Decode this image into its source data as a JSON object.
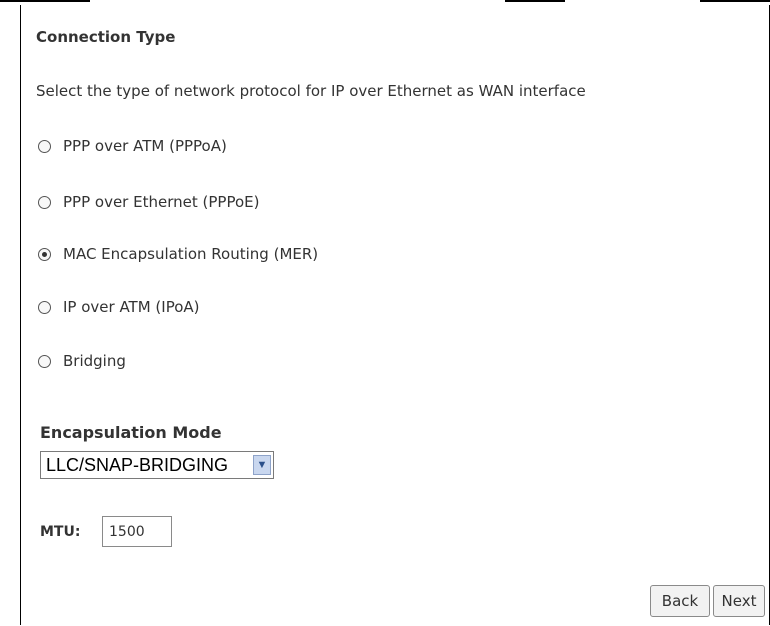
{
  "connection": {
    "title": "Connection Type",
    "description": "Select the type of network protocol for IP over Ethernet as WAN interface",
    "options": [
      {
        "label": "PPP over ATM (PPPoA)",
        "selected": false
      },
      {
        "label": "PPP over Ethernet (PPPoE)",
        "selected": false
      },
      {
        "label": "MAC Encapsulation Routing (MER)",
        "selected": true
      },
      {
        "label": "IP over ATM (IPoA)",
        "selected": false
      },
      {
        "label": "Bridging",
        "selected": false
      }
    ]
  },
  "encapsulation": {
    "title": "Encapsulation Mode",
    "selected_value": "LLC/SNAP-BRIDGING"
  },
  "mtu": {
    "label": "MTU:",
    "value": "1500"
  },
  "buttons": {
    "back": "Back",
    "next": "Next"
  }
}
